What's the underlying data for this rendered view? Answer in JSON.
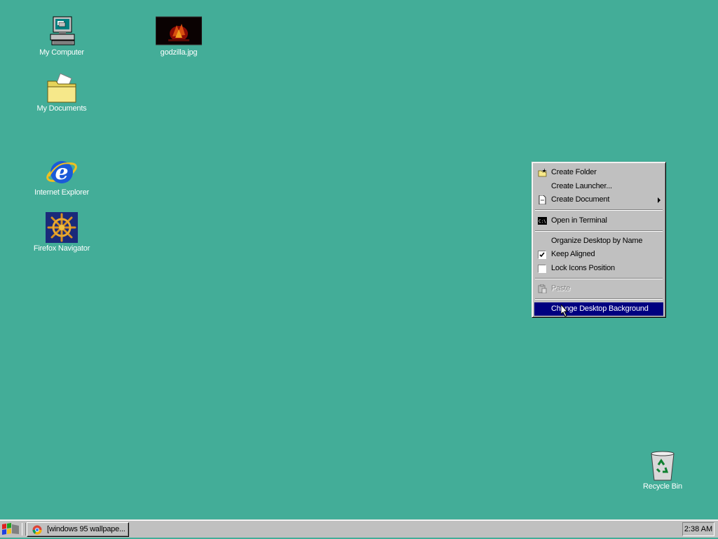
{
  "desktop": {
    "icons": [
      {
        "label": "My Computer",
        "icon": "computer-icon"
      },
      {
        "label": "godzilla.jpg",
        "icon": "image-file-icon"
      },
      {
        "label": "My Documents",
        "icon": "folder-icon"
      },
      {
        "label": "Internet Explorer",
        "icon": "internet-explorer-icon"
      },
      {
        "label": "Firefox Navigator",
        "icon": "ship-wheel-icon"
      },
      {
        "label": "Recycle Bin",
        "icon": "recycle-bin-icon"
      }
    ]
  },
  "context_menu": {
    "items": [
      {
        "label": "Create Folder",
        "icon": "new-folder-icon"
      },
      {
        "label": "Create Launcher...",
        "icon": ""
      },
      {
        "label": "Create Document",
        "icon": "document-icon",
        "submenu": true
      },
      {
        "label": "Open in Terminal",
        "icon": "terminal-icon"
      },
      {
        "label": "Organize Desktop by Name",
        "icon": ""
      },
      {
        "label": "Keep Aligned",
        "checked": true
      },
      {
        "label": "Lock Icons Position",
        "checked": false
      },
      {
        "label": "Paste",
        "icon": "paste-icon",
        "disabled": true
      },
      {
        "label": "Change Desktop Background",
        "highlighted": true
      }
    ]
  },
  "taskbar": {
    "task_label": "[windows 95 wallpape...",
    "clock": "2:38 AM"
  },
  "colors": {
    "desktop": "#43ad98",
    "menu_highlight": "#000080",
    "chrome": "#c0c0c0"
  }
}
